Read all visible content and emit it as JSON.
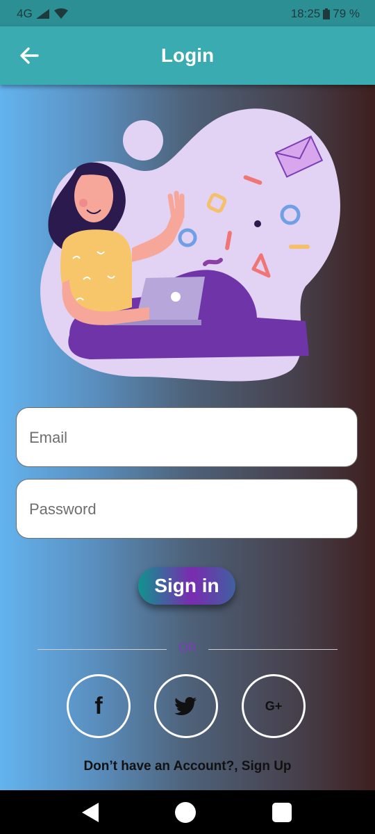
{
  "status_bar": {
    "network": "4G",
    "time": "18:25",
    "battery": "79 %",
    "icons": [
      "signal-icon",
      "wifi-icon",
      "battery-icon"
    ]
  },
  "app_bar": {
    "title": "Login",
    "back_icon": "arrow-left-icon"
  },
  "form": {
    "email_placeholder": "Email",
    "password_placeholder": "Password",
    "email_value": "",
    "password_value": ""
  },
  "actions": {
    "signin_label": "Sign in",
    "or_label": "OR",
    "signup_text": "Don’t have an Account?, Sign Up"
  },
  "social": [
    {
      "name": "facebook",
      "icon": "facebook-icon",
      "glyph": "f"
    },
    {
      "name": "twitter",
      "icon": "twitter-icon",
      "glyph": ""
    },
    {
      "name": "google-plus",
      "icon": "google-plus-icon",
      "glyph": "G+"
    }
  ],
  "nav_bar": {
    "icons": [
      "back-triangle-icon",
      "home-circle-icon",
      "recents-square-icon"
    ]
  },
  "colors": {
    "app_bar": "#3aabb1",
    "status_bar": "#2b8f94",
    "or_text": "#7b3fb5",
    "gradient_left": "#63b3ee",
    "gradient_right": "#3e1f1e"
  }
}
